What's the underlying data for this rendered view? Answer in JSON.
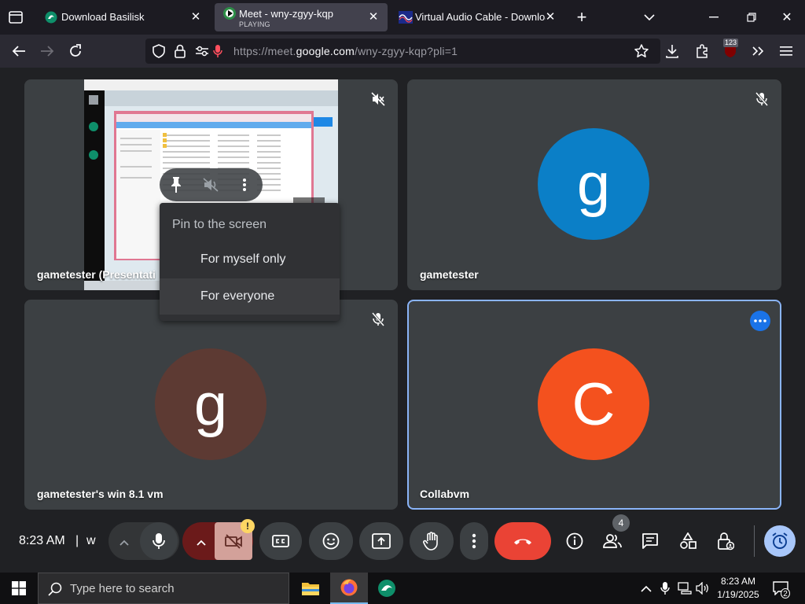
{
  "browser": {
    "tabs": [
      {
        "title": "Download Basilisk",
        "sub": "",
        "active": false
      },
      {
        "title": "Meet - wny-zgyy-kqp",
        "sub": "PLAYING",
        "active": true
      },
      {
        "title": "Virtual Audio Cable - Downloac",
        "sub": "",
        "active": false
      }
    ],
    "url": {
      "prefix": "https://meet.",
      "domain": "google.com",
      "suffix": "/wny-zgyy-kqp?pli=1"
    },
    "ext_badge": "123"
  },
  "tiles": [
    {
      "name": "gametester (Presentati",
      "kind": "share"
    },
    {
      "name": "gametester",
      "avatar_letter": "g",
      "avatar_color": "#0b7fc7"
    },
    {
      "name": "gametester's win 8.1 vm",
      "avatar_letter": "g",
      "avatar_color": "#5d3a33"
    },
    {
      "name": "Collabvm",
      "avatar_letter": "C",
      "avatar_color": "#f4511e"
    }
  ],
  "pin_menu": {
    "heading": "Pin to the screen",
    "items": [
      "For myself only",
      "For everyone"
    ]
  },
  "controls": {
    "time": "8:23 AM",
    "separator": "|",
    "meeting_code_fragment": "w",
    "people_count": "4",
    "warning_badge": "!"
  },
  "taskbar": {
    "search_placeholder": "Type here to search",
    "time": "8:23 AM",
    "date": "1/19/2025",
    "notifications": "2"
  },
  "colors": {
    "accent": "#1a73e8",
    "end_call": "#ea4335",
    "warning": "#fdd663",
    "cam_off": "#d3a19a"
  }
}
